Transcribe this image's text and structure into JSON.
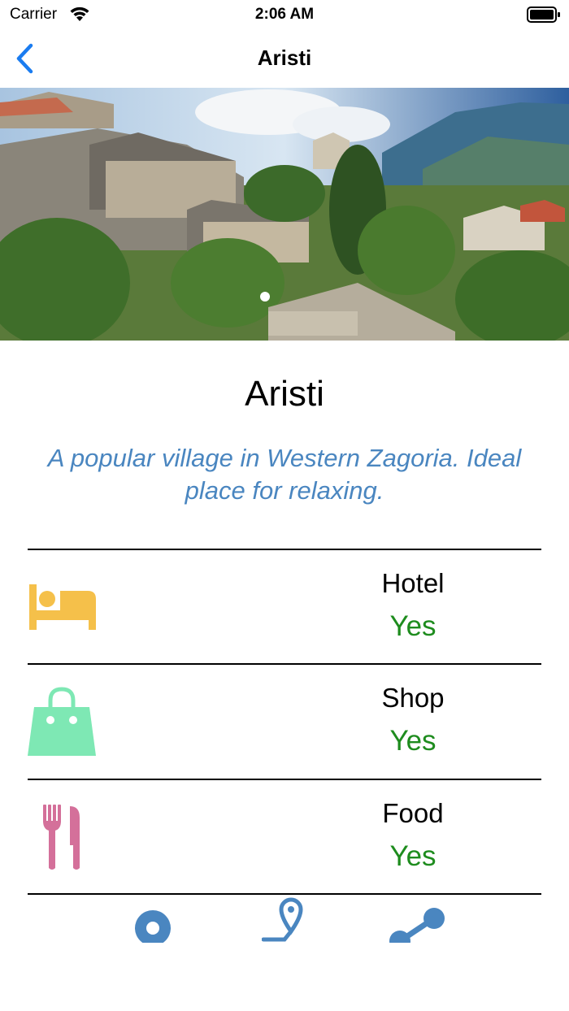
{
  "status_bar": {
    "carrier": "Carrier",
    "time": "2:06 AM"
  },
  "nav": {
    "title": "Aristi",
    "back_icon": "chevron-left-icon"
  },
  "hero": {
    "image": "village-photo",
    "page_count": 1,
    "current_page": 1
  },
  "place": {
    "name": "Aristi",
    "description": "A popular village in Western Zagoria. Ideal place for relaxing."
  },
  "amenities": [
    {
      "label": "Hotel",
      "value": "Yes",
      "icon": "bed-icon",
      "icon_color": "#f5c04a"
    },
    {
      "label": "Shop",
      "value": "Yes",
      "icon": "shopping-bag-icon",
      "icon_color": "#7ee8b4"
    },
    {
      "label": "Food",
      "value": "Yes",
      "icon": "fork-knife-icon",
      "icon_color": "#d4709a"
    }
  ],
  "tabs": [
    {
      "icon": "location-circle-icon"
    },
    {
      "icon": "map-pin-route-icon"
    },
    {
      "icon": "share-route-icon"
    }
  ],
  "colors": {
    "accent": "#1a7cf0",
    "description": "#4a86c0",
    "yes": "#1e8c1e",
    "tab_icon": "#4a86c0"
  }
}
